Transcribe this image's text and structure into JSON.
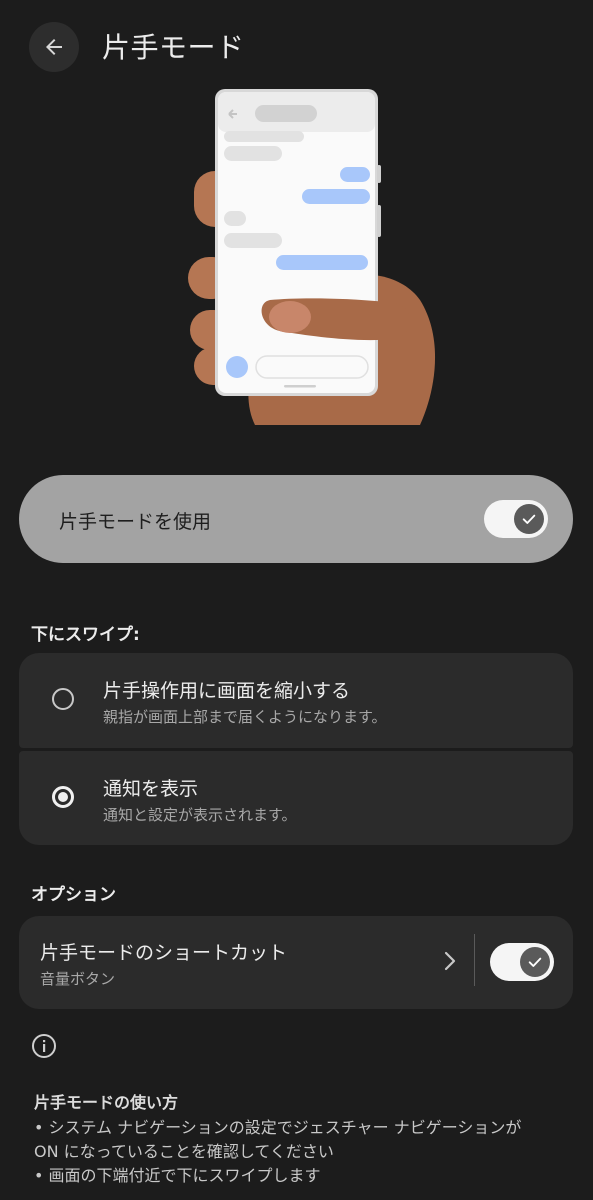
{
  "header": {
    "title": "片手モード",
    "back_icon": "arrow-left-icon"
  },
  "illustration": {
    "icon": "hand-holding-phone-illustration"
  },
  "main_toggle": {
    "label": "片手モードを使用",
    "checked": true
  },
  "swipe_section": {
    "header": "下にスワイプ:",
    "options": [
      {
        "title": "片手操作用に画面を縮小する",
        "subtitle": "親指が画面上部まで届くようになります。",
        "selected": false
      },
      {
        "title": "通知を表示",
        "subtitle": "通知と設定が表示されます。",
        "selected": true
      }
    ]
  },
  "options_section": {
    "header": "オプション",
    "shortcut": {
      "title": "片手モードのショートカット",
      "subtitle": "音量ボタン",
      "checked": true
    }
  },
  "info": {
    "icon": "info-icon",
    "title": "片手モードの使い方",
    "lines": [
      "• システム ナビゲーションの設定でジェスチャー ナビゲーションが",
      "ON になっていることを確認してください",
      "• 画面の下端付近で下にスワイプします"
    ]
  },
  "colors": {
    "background": "#1c1c1c",
    "card": "#2b2b2b",
    "main_toggle_bg": "#a3a3a3",
    "accent_blue": "#a8c7fa",
    "skin": "#b07554"
  }
}
